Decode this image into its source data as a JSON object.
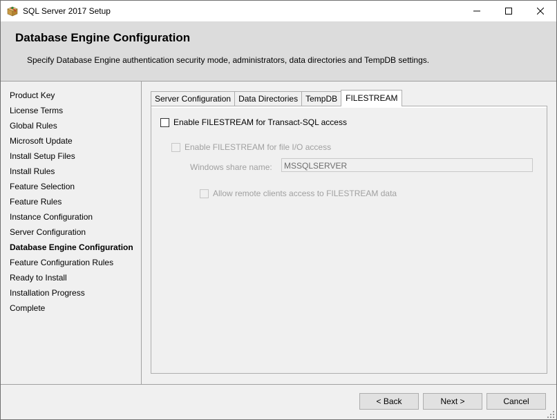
{
  "window": {
    "title": "SQL Server 2017 Setup",
    "icon": "sql-setup-box-icon"
  },
  "header": {
    "title": "Database Engine Configuration",
    "subtitle": "Specify Database Engine authentication security mode, administrators, data directories and TempDB settings."
  },
  "sidebar": {
    "items": [
      {
        "label": "Product Key"
      },
      {
        "label": "License Terms"
      },
      {
        "label": "Global Rules"
      },
      {
        "label": "Microsoft Update"
      },
      {
        "label": "Install Setup Files"
      },
      {
        "label": "Install Rules"
      },
      {
        "label": "Feature Selection"
      },
      {
        "label": "Feature Rules"
      },
      {
        "label": "Instance Configuration"
      },
      {
        "label": "Server Configuration"
      },
      {
        "label": "Database Engine Configuration",
        "active": true
      },
      {
        "label": "Feature Configuration Rules"
      },
      {
        "label": "Ready to Install"
      },
      {
        "label": "Installation Progress"
      },
      {
        "label": "Complete"
      }
    ]
  },
  "tabs": [
    {
      "label": "Server Configuration"
    },
    {
      "label": "Data Directories"
    },
    {
      "label": "TempDB"
    },
    {
      "label": "FILESTREAM",
      "active": true
    }
  ],
  "filestream": {
    "enable_tsql_label": "Enable FILESTREAM for Transact-SQL access",
    "enable_tsql_checked": false,
    "enable_fileio_label": "Enable FILESTREAM for file I/O access",
    "share_name_label": "Windows share name:",
    "share_name_value": "MSSQLSERVER",
    "allow_remote_label": "Allow remote clients access to FILESTREAM data"
  },
  "footer": {
    "back_label": "< Back",
    "next_label": "Next >",
    "cancel_label": "Cancel"
  }
}
